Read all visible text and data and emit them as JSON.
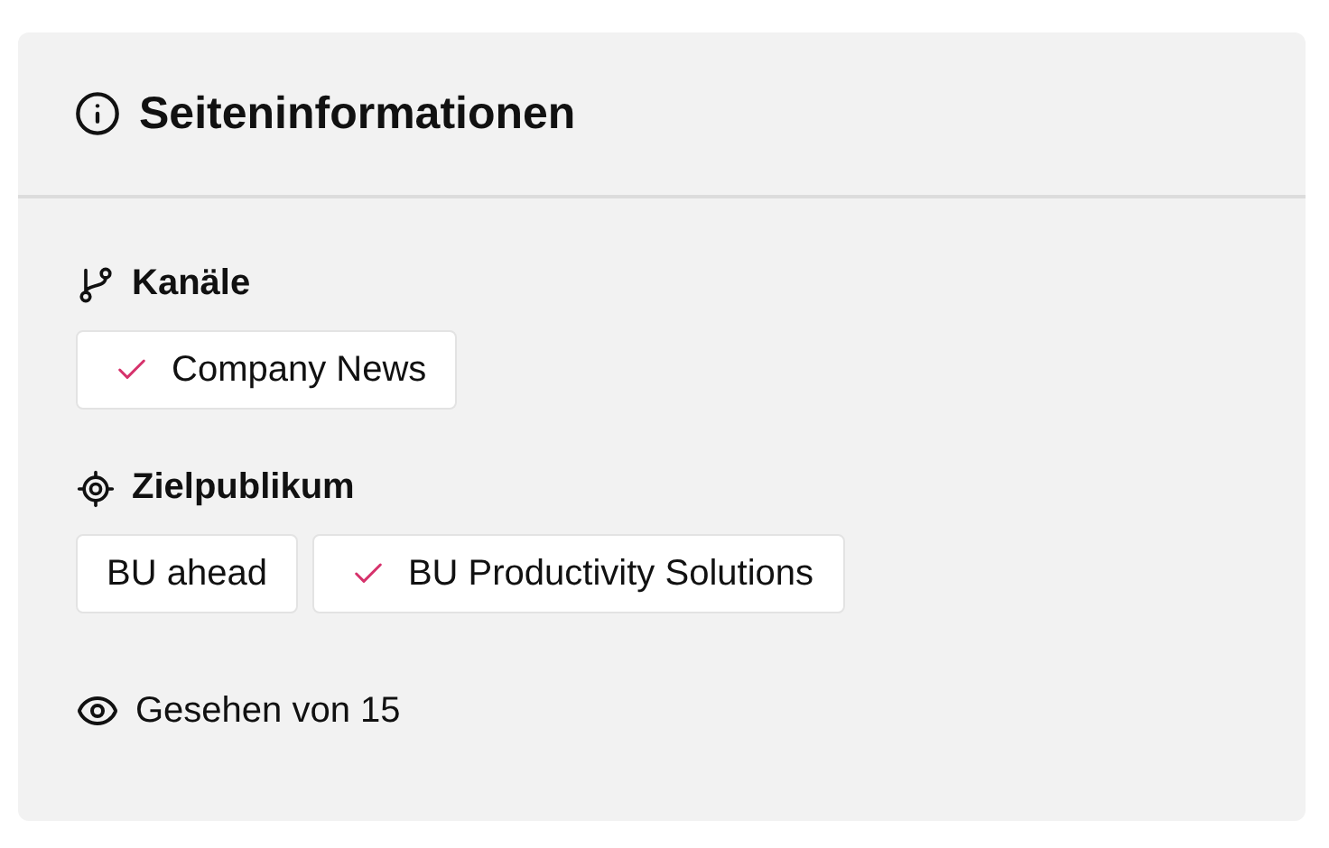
{
  "panel": {
    "title": "Seiteninformationen"
  },
  "sections": [
    {
      "kind": "channels",
      "label": "Kanäle",
      "tags": [
        {
          "label": "Company News",
          "checked": true
        }
      ]
    },
    {
      "kind": "audience",
      "label": "Zielpublikum",
      "tags": [
        {
          "label": "BU ahead",
          "checked": false
        },
        {
          "label": "BU Productivity Solutions",
          "checked": true
        }
      ]
    }
  ],
  "views": {
    "label": "Gesehen von 15"
  }
}
